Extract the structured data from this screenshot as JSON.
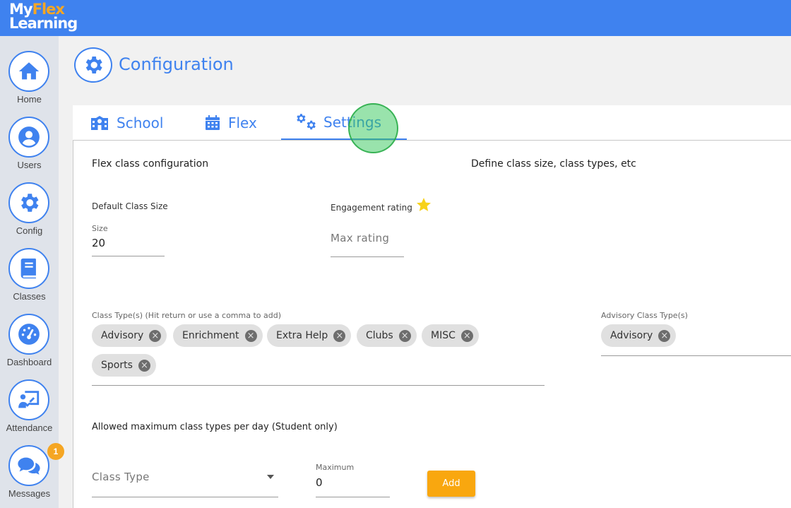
{
  "app": {
    "logo_line1_a": "My",
    "logo_line1_b": "Flex",
    "logo_line2": "Learning"
  },
  "colors": {
    "brand_blue": "#3f82ef",
    "accent_orange": "#f9a70f",
    "sidebar_bg": "#dfe3ea",
    "chip_bg": "#e0e0e0"
  },
  "sidebar": {
    "items": [
      {
        "label": "Home",
        "icon": "home-icon"
      },
      {
        "label": "Users",
        "icon": "user-icon"
      },
      {
        "label": "Config",
        "icon": "gear-icon"
      },
      {
        "label": "Classes",
        "icon": "book-icon"
      },
      {
        "label": "Dashboard",
        "icon": "gauge-icon"
      },
      {
        "label": "Attendance",
        "icon": "presentation-icon"
      },
      {
        "label": "Messages",
        "icon": "chat-icon",
        "badge": "1"
      }
    ]
  },
  "header": {
    "title": "Configuration",
    "icon": "gear-icon"
  },
  "tabs": [
    {
      "label": "School",
      "icon": "school-icon"
    },
    {
      "label": "Flex",
      "icon": "calendar-icon"
    },
    {
      "label": "Settings",
      "icon": "gears-icon",
      "active": true
    }
  ],
  "settings": {
    "section_title": "Flex class configuration",
    "section_desc": "Define class size, class types, etc",
    "default_class_size": {
      "heading": "Default Class Size",
      "field_label": "Size",
      "value": "20"
    },
    "engagement": {
      "heading": "Engagement rating",
      "icon": "star-icon",
      "placeholder": "Max rating"
    },
    "class_types": {
      "label": "Class Type(s) (Hit return or use a comma to add)",
      "chips": [
        "Advisory",
        "Enrichment",
        "Extra Help",
        "Clubs",
        "MISC",
        "Sports"
      ]
    },
    "advisory_types": {
      "label": "Advisory Class Type(s)",
      "chips": [
        "Advisory"
      ]
    },
    "max_per_day": {
      "heading": "Allowed maximum class types per day (Student only)",
      "class_type_placeholder": "Class Type",
      "maximum_label": "Maximum",
      "maximum_value": "0",
      "add_label": "Add"
    }
  }
}
